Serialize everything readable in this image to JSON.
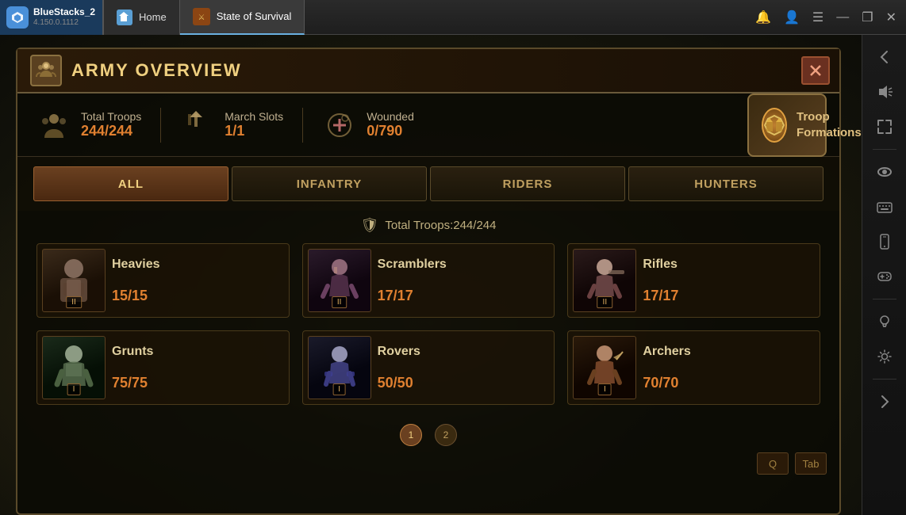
{
  "app": {
    "name": "BlueStacks_2",
    "version": "4.150.0.1112"
  },
  "topbar": {
    "home_tab": "Home",
    "game_tab": "State of Survival",
    "close_label": "✕",
    "minimize_label": "—",
    "restore_label": "❐",
    "icons": [
      "🔔",
      "👤",
      "☰",
      "—",
      "❐",
      "✕"
    ]
  },
  "panel": {
    "title": "ARMY OVERVIEW",
    "close_btn": "✕"
  },
  "stats": {
    "total_troops_label": "Total Troops",
    "total_troops_value": "244/244",
    "march_slots_label": "March Slots",
    "march_slots_value": "1/1",
    "wounded_label": "Wounded",
    "wounded_value": "0/790",
    "troop_formations_label": "Troop Formations"
  },
  "tabs": [
    {
      "id": "all",
      "label": "ALL",
      "active": true
    },
    {
      "id": "infantry",
      "label": "INFANTRY",
      "active": false
    },
    {
      "id": "riders",
      "label": "RIDERS",
      "active": false
    },
    {
      "id": "hunters",
      "label": "HUNTERS",
      "active": false
    }
  ],
  "total_troops_line": "Total Troops:244/244",
  "troops": [
    {
      "id": "heavies",
      "name": "Heavies",
      "count": "15/15",
      "tier": "II",
      "portrait_class": "portrait-heavies",
      "emoji": "👊"
    },
    {
      "id": "scramblers",
      "name": "Scramblers",
      "count": "17/17",
      "tier": "II",
      "portrait_class": "portrait-scramblers",
      "emoji": "🏍"
    },
    {
      "id": "rifles",
      "name": "Rifles",
      "count": "17/17",
      "tier": "II",
      "portrait_class": "portrait-rifles",
      "emoji": "🔫"
    },
    {
      "id": "grunts",
      "name": "Grunts",
      "count": "75/75",
      "tier": "I",
      "portrait_class": "portrait-grunts",
      "emoji": "💪"
    },
    {
      "id": "rovers",
      "name": "Rovers",
      "count": "50/50",
      "tier": "I",
      "portrait_class": "portrait-rovers",
      "emoji": "🚗"
    },
    {
      "id": "archers",
      "name": "Archers",
      "count": "70/70",
      "tier": "I",
      "portrait_class": "portrait-archers",
      "emoji": "🏹"
    }
  ],
  "pagination": {
    "pages": [
      "1",
      "2"
    ],
    "active_page": 0
  },
  "bottom_buttons": {
    "q_label": "Q",
    "tab_label": "Tab"
  }
}
